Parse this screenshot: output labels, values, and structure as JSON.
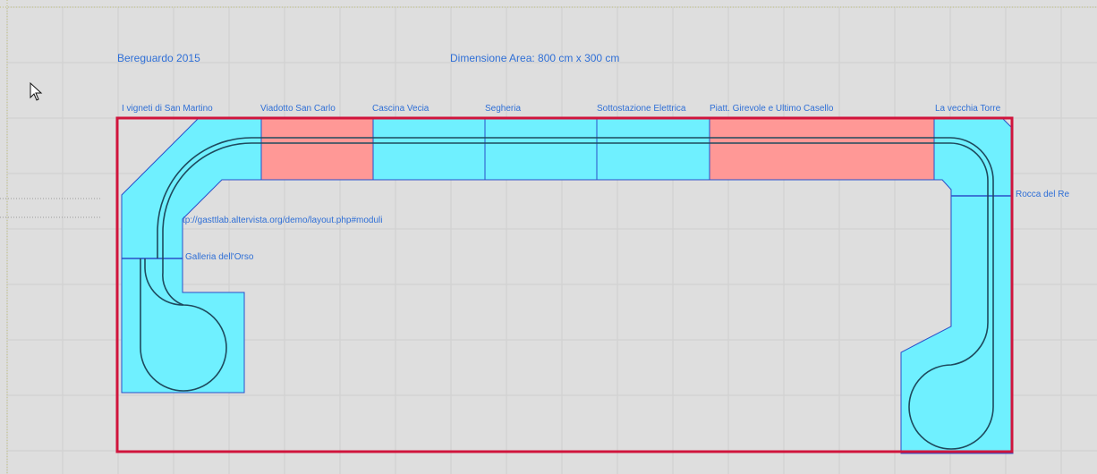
{
  "header": {
    "project_name": "Bereguardo 2015",
    "area_dimensions": "Dimensione Area: 800 cm x 300 cm"
  },
  "modules": {
    "vigneti": "I vigneti di San Martino",
    "viadotto": "Viadotto San Carlo",
    "cascina": "Cascina Vecia",
    "segheria": "Segheria",
    "sottostazione": "Sottostazione Elettrica",
    "piattaforma": "Piatt. Girevole e Ultimo Casello",
    "torre": "La vecchia Torre",
    "rocca": "Rocca del Re",
    "galleria": "Galleria dell'Orso"
  },
  "link_text": "tp://gasttlab.altervista.org/demo/layout.php#moduli",
  "colors": {
    "border": "#d0143c",
    "module_fill": "#6ff0ff",
    "module_red": "#ff9896",
    "outline": "#2a4fc9",
    "track": "#1e4a5e",
    "label": "#2f6fd6"
  },
  "icons": {
    "cursor": "mouse-pointer-icon"
  }
}
